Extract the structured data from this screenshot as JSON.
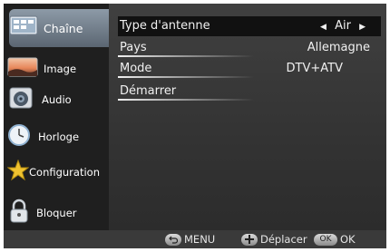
{
  "sidebar": {
    "items": [
      {
        "label": "Chaîne",
        "icon": "tv-channel-icon",
        "active": true
      },
      {
        "label": "Image",
        "icon": "picture-icon"
      },
      {
        "label": "Audio",
        "icon": "speaker-icon"
      },
      {
        "label": "Horloge",
        "icon": "clock-icon"
      },
      {
        "label": "Configuration",
        "icon": "star-icon"
      },
      {
        "label": "Bloquer",
        "icon": "lock-icon"
      }
    ]
  },
  "menu": {
    "rows": [
      {
        "label": "Type d'antenne",
        "value": "Air",
        "selected": true
      },
      {
        "label": "Pays",
        "value": "Allemagne"
      },
      {
        "label": "Mode",
        "value": "DTV+ATV"
      },
      {
        "label": "Démarrer",
        "value": ""
      }
    ]
  },
  "footer": {
    "menu_label": "MENU",
    "move_label": "Déplacer",
    "ok_badge": "OK",
    "ok_label": "OK"
  },
  "colors": {
    "selected_row": "#111111",
    "content_bg": "#3a3a3a",
    "active_tab": "#7a8794"
  }
}
